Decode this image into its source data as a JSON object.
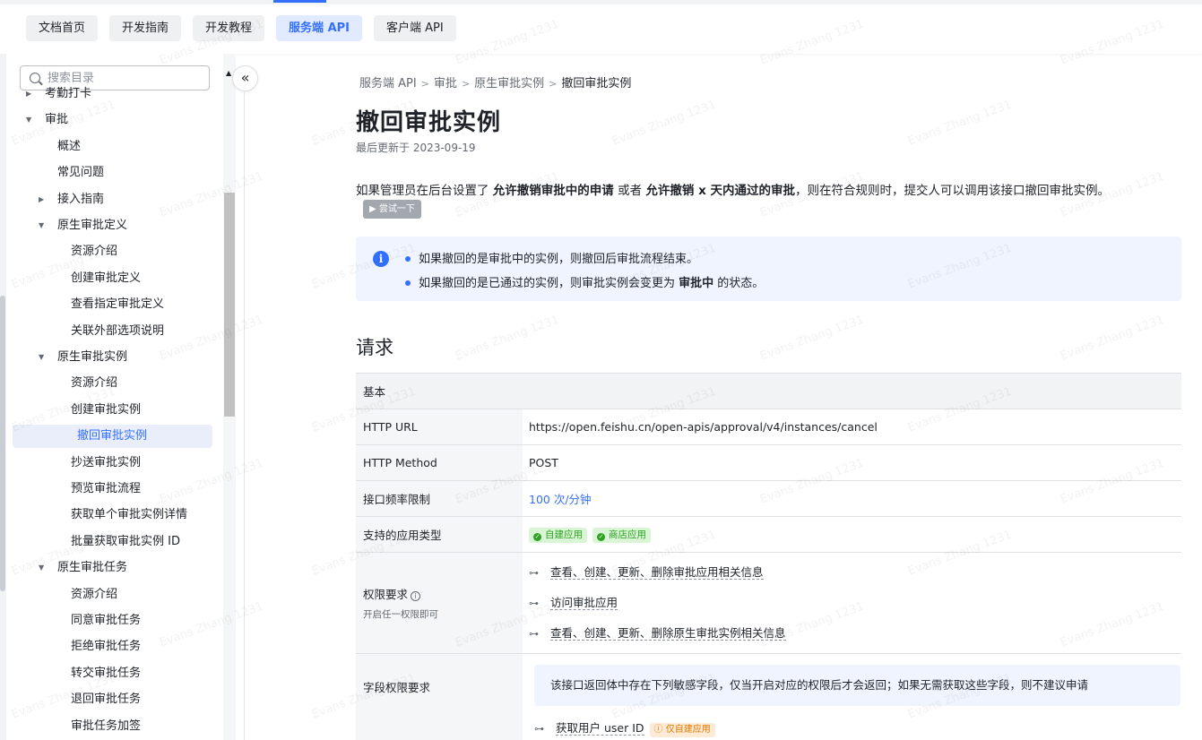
{
  "topnav": {
    "tabs": [
      {
        "label": "文档首页",
        "active": false
      },
      {
        "label": "开发指南",
        "active": false
      },
      {
        "label": "开发教程",
        "active": false
      },
      {
        "label": "服务端 API",
        "active": true
      },
      {
        "label": "客户端 API",
        "active": false
      }
    ]
  },
  "sidebar": {
    "search_placeholder": "搜索目录",
    "items": [
      {
        "label": "考勤打卡",
        "level": 0,
        "caret": "right"
      },
      {
        "label": "审批",
        "level": 0,
        "caret": "down"
      },
      {
        "label": "概述",
        "level": 1,
        "caret": ""
      },
      {
        "label": "常见问题",
        "level": 1,
        "caret": ""
      },
      {
        "label": "接入指南",
        "level": 1,
        "caret": "right"
      },
      {
        "label": "原生审批定义",
        "level": 1,
        "caret": "down"
      },
      {
        "label": "资源介绍",
        "level": 2,
        "caret": ""
      },
      {
        "label": "创建审批定义",
        "level": 2,
        "caret": ""
      },
      {
        "label": "查看指定审批定义",
        "level": 2,
        "caret": ""
      },
      {
        "label": "关联外部选项说明",
        "level": 2,
        "caret": ""
      },
      {
        "label": "原生审批实例",
        "level": 1,
        "caret": "down"
      },
      {
        "label": "资源介绍",
        "level": 2,
        "caret": ""
      },
      {
        "label": "创建审批实例",
        "level": 2,
        "caret": ""
      },
      {
        "label": "撤回审批实例",
        "level": 2,
        "caret": "",
        "active": true
      },
      {
        "label": "抄送审批实例",
        "level": 2,
        "caret": ""
      },
      {
        "label": "预览审批流程",
        "level": 2,
        "caret": ""
      },
      {
        "label": "获取单个审批实例详情",
        "level": 2,
        "caret": ""
      },
      {
        "label": "批量获取审批实例 ID",
        "level": 2,
        "caret": ""
      },
      {
        "label": "原生审批任务",
        "level": 1,
        "caret": "down"
      },
      {
        "label": "资源介绍",
        "level": 2,
        "caret": ""
      },
      {
        "label": "同意审批任务",
        "level": 2,
        "caret": ""
      },
      {
        "label": "拒绝审批任务",
        "level": 2,
        "caret": ""
      },
      {
        "label": "转交审批任务",
        "level": 2,
        "caret": ""
      },
      {
        "label": "退回审批任务",
        "level": 2,
        "caret": ""
      },
      {
        "label": "审批任务加签",
        "level": 2,
        "caret": ""
      }
    ]
  },
  "breadcrumb": [
    "服务端 API",
    "审批",
    "原生审批实例",
    "撤回审批实例"
  ],
  "page": {
    "title": "撤回审批实例",
    "updated": "最后更新于 2023-09-19",
    "desc_parts": [
      "如果管理员在后台设置了 ",
      "允许撤销审批中的申请",
      " 或者 ",
      "允许撤销 x 天内通过的审批",
      "，则在符合规则时，提交人可以调用该接口撤回审批实例。"
    ],
    "try_button": "▶ 尝试一下",
    "notes": [
      [
        "如果撤回的是审批中的实例，则撤回后审批流程结束。",
        "",
        ""
      ],
      [
        "如果撤回的是已通过的实例，则审批实例会变更为 ",
        "审批中",
        " 的状态。"
      ]
    ],
    "section_request": "请求"
  },
  "table": {
    "header": "基本",
    "http_url_label": "HTTP URL",
    "http_url": "https://open.feishu.cn/open-apis/approval/v4/instances/cancel",
    "http_method_label": "HTTP Method",
    "http_method": "POST",
    "rate_label": "接口频率限制",
    "rate": "100 次/分钟",
    "app_type_label": "支持的应用类型",
    "app_types": [
      "自建应用",
      "商店应用"
    ],
    "perm_label": "权限要求",
    "perm_sub": "开启任一权限即可",
    "perms": [
      "查看、创建、更新、删除审批应用相关信息",
      "访问审批应用",
      "查看、创建、更新、删除原生审批实例相关信息"
    ],
    "field_perm_label": "字段权限要求",
    "field_note": "该接口返回体中存在下列敏感字段，仅当开启对应的权限后才会返回；如果无需获取这些字段，则不建议申请",
    "field_perm": "获取用户 user ID",
    "field_perm_badge": "仅自建应用"
  },
  "watermark": "Evans Zhang 1231",
  "colors": {
    "accent": "#3370ff",
    "success": "#2ea121",
    "warning": "#de7802"
  }
}
